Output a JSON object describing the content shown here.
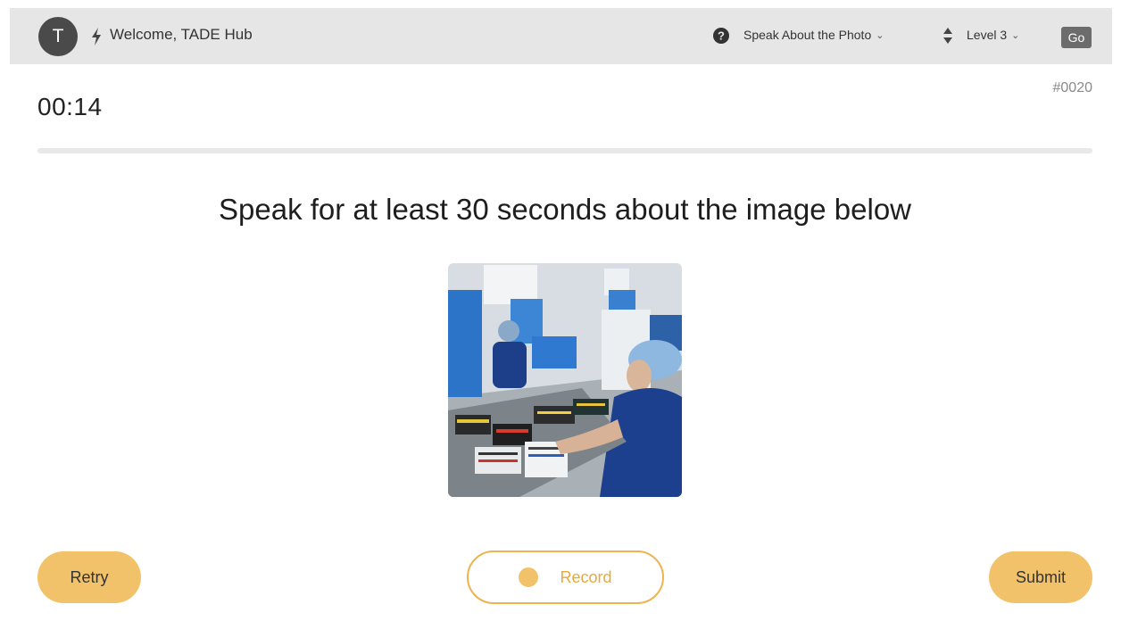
{
  "header": {
    "avatar_initial": "T",
    "welcome_text": "Welcome, TADE Hub",
    "mode_label": "Speak About the Photo",
    "level_label": "Level 3",
    "go_label": "Go",
    "icons": [
      "bolt-icon",
      "help-circle-icon",
      "chevron-down-icon",
      "sort-updown-icon"
    ]
  },
  "task": {
    "timer": "00:14",
    "item_id": "#0020",
    "prompt": "Speak for at least 30 seconds about the image below"
  },
  "actions": {
    "retry_label": "Retry",
    "record_label": "Record",
    "submit_label": "Submit"
  },
  "colors": {
    "accent": "#f2c26a",
    "record_border": "#eeb24f",
    "topbar_bg": "#e6e6e6",
    "avatar_bg": "#4a4a4a"
  }
}
